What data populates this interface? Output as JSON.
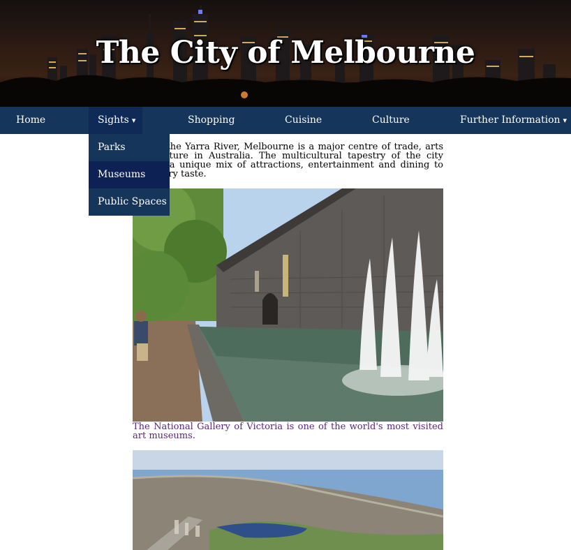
{
  "header": {
    "title": "The City of Melbourne"
  },
  "nav": {
    "items": [
      {
        "label": "Home"
      },
      {
        "label": "Sights",
        "caret": "▾"
      },
      {
        "label": "Shopping"
      },
      {
        "label": "Cuisine"
      },
      {
        "label": "Culture"
      },
      {
        "label": "Further Information",
        "caret": "▾"
      }
    ],
    "dropdown": [
      {
        "label": "Parks"
      },
      {
        "label": "Museums"
      },
      {
        "label": "Public Spaces"
      }
    ]
  },
  "content": {
    "intro": "Set on the Yarra River, Melbourne is a major centre of trade, arts and culture in Australia. The multicultural tapestry of the city affords a unique mix of attractions, entertainment and dining to suit every taste.",
    "caption": "The National Gallery of Victoria is one of the world's most visited art museums."
  },
  "colors": {
    "nav_bg": "#16355a",
    "nav_active": "#0f2a57",
    "dropdown_hover": "#0e2154",
    "caption": "#5a2577"
  }
}
